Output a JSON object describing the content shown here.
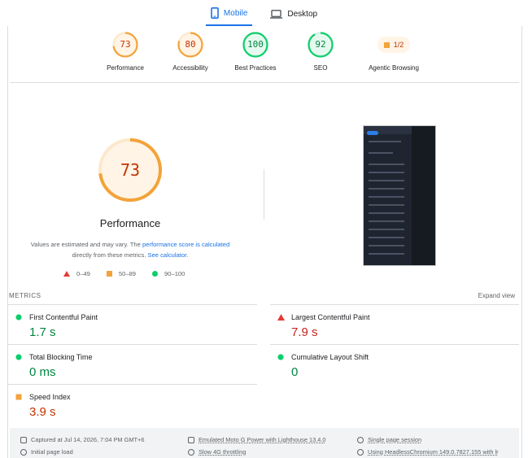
{
  "tabs": [
    {
      "label": "Mobile",
      "icon": "phone-icon",
      "active": true
    },
    {
      "label": "Desktop",
      "icon": "laptop-icon",
      "active": false
    }
  ],
  "summary": [
    {
      "value": "73",
      "label": "Performance",
      "score": 73,
      "color": "#f2a33a",
      "text_color": "#c33300",
      "bg": "#fff4e5"
    },
    {
      "value": "80",
      "label": "Accessibility",
      "score": 80,
      "color": "#f2a33a",
      "text_color": "#c33300",
      "bg": "#fff4e5"
    },
    {
      "value": "100",
      "label": "Best Practices",
      "score": 100,
      "color": "#0cce6b",
      "text_color": "#018642",
      "bg": "#e6f9ef"
    },
    {
      "value": "92",
      "label": "SEO",
      "score": 92,
      "color": "#0cce6b",
      "text_color": "#018642",
      "bg": "#e6f9ef"
    }
  ],
  "agentic": {
    "value": "1/2",
    "label": "Agentic Browsing"
  },
  "performance": {
    "score": 73,
    "score_text": "73",
    "title": "Performance",
    "note_prefix": "Values are estimated and may vary. The ",
    "note_link1": "performance score is calculated",
    "note_mid": "directly from these metrics. ",
    "note_link2": "See calculator",
    "note_end": "."
  },
  "legend": [
    {
      "label": "0–49",
      "icon": "triangle-fail-icon"
    },
    {
      "label": "50–89",
      "icon": "square-average-icon"
    },
    {
      "label": "90–100",
      "icon": "circle-pass-icon"
    }
  ],
  "metrics_header": {
    "title": "METRICS",
    "expand": "Expand view"
  },
  "metrics": [
    {
      "title": "First Contentful Paint",
      "value": "1.7 s",
      "rating": "good"
    },
    {
      "title": "Largest Contentful Paint",
      "value": "7.9 s",
      "rating": "bad"
    },
    {
      "title": "Total Blocking Time",
      "value": "0 ms",
      "rating": "good"
    },
    {
      "title": "Cumulative Layout Shift",
      "value": "0",
      "rating": "good"
    },
    {
      "title": "Speed Index",
      "value": "3.9 s",
      "rating": "avg"
    }
  ],
  "footer": [
    {
      "text": "Captured at Jul 14, 2026, 7:04 PM GMT+6",
      "icon": "calendar-icon"
    },
    {
      "text": "Emulated Moto G Power with Lighthouse 13.4.0",
      "icon": "device-icon"
    },
    {
      "text": "Single page session",
      "icon": "user-icon"
    },
    {
      "text": "Initial page load",
      "icon": "timer-icon"
    },
    {
      "text": "Slow 4G throttling",
      "icon": "wifi-icon"
    },
    {
      "text": "Using HeadlessChromium 149.0.7827.155 with lr",
      "icon": "chrome-icon"
    }
  ]
}
